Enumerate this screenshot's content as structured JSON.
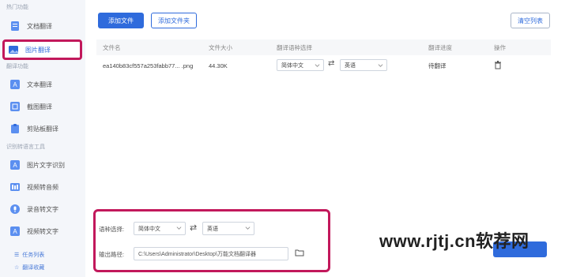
{
  "sidebar": {
    "section_hot": "热门功能",
    "section_translate": "翻译功能",
    "section_ocr": "识别转语言工具",
    "items": [
      {
        "label": "文档翻译",
        "icon": "document-icon"
      },
      {
        "label": "图片翻译",
        "icon": "image-icon"
      },
      {
        "label": "文本翻译",
        "icon": "text-icon"
      },
      {
        "label": "截图翻译",
        "icon": "screenshot-icon"
      },
      {
        "label": "剪贴板翻译",
        "icon": "clipboard-icon"
      },
      {
        "label": "图片文字识别",
        "icon": "ocr-icon"
      },
      {
        "label": "视频转音频",
        "icon": "video-icon"
      },
      {
        "label": "录音转文字",
        "icon": "mic-icon"
      },
      {
        "label": "视频转文字",
        "icon": "video-text-icon"
      }
    ],
    "bottom": {
      "tasks": "任务列表",
      "favorites": "翻译收藏"
    }
  },
  "toolbar": {
    "add_file": "添加文件",
    "add_folder": "添加文件夹",
    "clear_list": "清空列表"
  },
  "table": {
    "headers": {
      "name": "文件名",
      "size": "文件大小",
      "lang": "翻译语种选择",
      "progress": "翻译进度",
      "action": "操作"
    },
    "rows": [
      {
        "name": "ea140b83cf557a253fabb77... .png",
        "size": "44.30K",
        "from": "简体中文",
        "to": "英语",
        "progress": "待翻译"
      }
    ]
  },
  "bottom": {
    "lang_label": "语种选择:",
    "from": "简体中文",
    "to": "英语",
    "path_label": "输出路径:",
    "path": "C:\\Users\\Administrator\\Desktop\\万能文档翻译器"
  },
  "watermark": "www.rjtj.cn软荐网",
  "colors": {
    "accent": "#2f6bdc",
    "highlight": "#c2185b"
  }
}
